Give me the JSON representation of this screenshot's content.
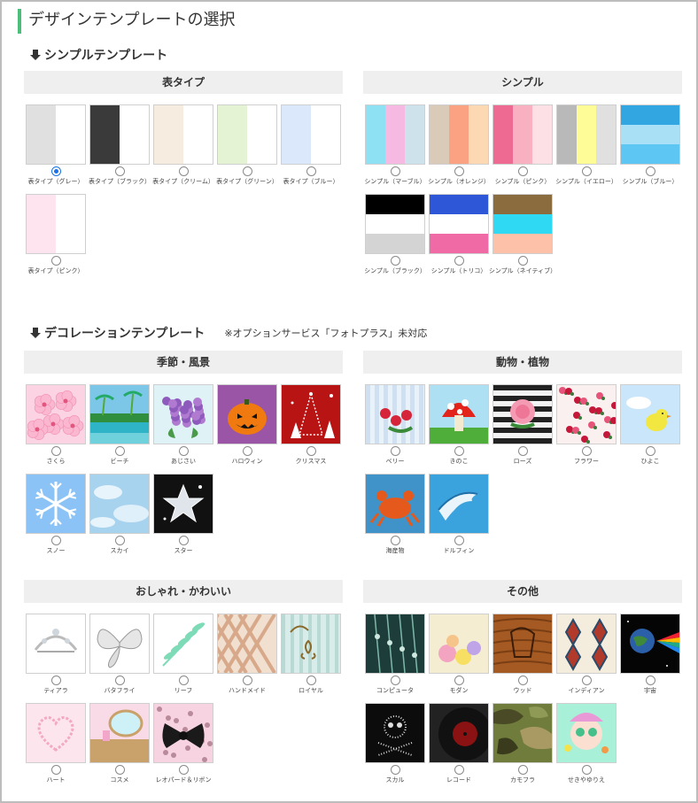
{
  "page_title": "デザインテンプレートの選択",
  "simple_section": {
    "title": "シンプルテンプレート",
    "groups": [
      {
        "header": "表タイプ",
        "items": [
          {
            "label": "表タイプ（グレー）",
            "selected": true,
            "colors": [
              "#e0e0e0",
              "#ffffff"
            ]
          },
          {
            "label": "表タイプ（ブラック）",
            "colors": [
              "#3a3a3a",
              "#ffffff"
            ]
          },
          {
            "label": "表タイプ（クリーム）",
            "colors": [
              "#f6ece0",
              "#ffffff"
            ]
          },
          {
            "label": "表タイプ（グリーン）",
            "colors": [
              "#e3f3d3",
              "#ffffff"
            ]
          },
          {
            "label": "表タイプ（ブルー）",
            "colors": [
              "#dbe8fb",
              "#ffffff"
            ]
          },
          {
            "label": "表タイプ（ピンク）",
            "colors": [
              "#fde4ef",
              "#ffffff"
            ]
          }
        ]
      },
      {
        "header": "シンプル",
        "items": [
          {
            "label": "シンプル（マーブル）",
            "colors": [
              "#8ee0f3",
              "#f6b9e1",
              "#cde2ea"
            ]
          },
          {
            "label": "シンプル（オレンジ）",
            "colors": [
              "#d9cbb7",
              "#fba282",
              "#fcd8b3"
            ]
          },
          {
            "label": "シンプル（ピンク）",
            "colors": [
              "#ef6a93",
              "#f9b1c2",
              "#fde0e6"
            ]
          },
          {
            "label": "シンプル（イエロー）",
            "colors": [
              "#b9b9b9",
              "#fdfc96",
              "#e0e0e0"
            ]
          },
          {
            "label": "シンプル（ブルー）",
            "colors": [
              "#31a6e0",
              "#a9e0f6",
              "#5ec6f2"
            ]
          },
          {
            "label": "シンプル（ブラック）",
            "colors": [
              "#000000",
              "#ffffff",
              "#d4d4d4"
            ]
          },
          {
            "label": "シンプル（トリコ）",
            "colors": [
              "#2d57d6",
              "#ffffff",
              "#f06aa6"
            ]
          },
          {
            "label": "シンプル（ネイティブ）",
            "colors": [
              "#8b6c3f",
              "#2fd9f4",
              "#fdc0a8"
            ]
          }
        ]
      }
    ]
  },
  "deco_section": {
    "title": "デコレーションテンプレート",
    "note": "※オプションサービス「フォトプラス」未対応",
    "groups": [
      {
        "header": "季節・風景",
        "items": [
          {
            "label": "さくら",
            "icon": "sakura-icon",
            "bg": "#fbd3e3"
          },
          {
            "label": "ビーチ",
            "icon": "beach-icon",
            "bg": "#7cc6e8"
          },
          {
            "label": "あじさい",
            "icon": "hydrangea-icon",
            "bg": "#dff3f6"
          },
          {
            "label": "ハロウィン",
            "icon": "pumpkin-icon",
            "bg": "#9a55a6"
          },
          {
            "label": "クリスマス",
            "icon": "christmas-tree-icon",
            "bg": "#b81414"
          },
          {
            "label": "スノー",
            "icon": "snowflake-icon",
            "bg": "#8cc3f6"
          },
          {
            "label": "スカイ",
            "icon": "sky-icon",
            "bg": "#a7d3ef"
          },
          {
            "label": "スター",
            "icon": "star-icon",
            "bg": "#111111"
          }
        ]
      },
      {
        "header": "動物・植物",
        "items": [
          {
            "label": "ベリー",
            "icon": "berry-icon",
            "bg": "#e8f2fa"
          },
          {
            "label": "きのこ",
            "icon": "mushroom-icon",
            "bg": "#aee0f4"
          },
          {
            "label": "ローズ",
            "icon": "rose-icon",
            "bg": "#f3f3f3"
          },
          {
            "label": "フラワー",
            "icon": "flower-icon",
            "bg": "#fbf0f0"
          },
          {
            "label": "ひよこ",
            "icon": "chick-icon",
            "bg": "#c9e6fa"
          },
          {
            "label": "海産物",
            "icon": "crab-icon",
            "bg": "#3f93c8"
          },
          {
            "label": "ドルフィン",
            "icon": "dolphin-icon",
            "bg": "#3aa2dc"
          }
        ]
      },
      {
        "header": "おしゃれ・かわいい",
        "items": [
          {
            "label": "ティアラ",
            "icon": "tiara-icon",
            "bg": "#ffffff"
          },
          {
            "label": "バタフライ",
            "icon": "butterfly-icon",
            "bg": "#ffffff"
          },
          {
            "label": "リーフ",
            "icon": "leaf-icon",
            "bg": "#ffffff"
          },
          {
            "label": "ハンドメイド",
            "icon": "handmade-icon",
            "bg": "#f1dfcf"
          },
          {
            "label": "ロイヤル",
            "icon": "royal-icon",
            "bg": "#d8ecea"
          },
          {
            "label": "ハート",
            "icon": "heart-icon",
            "bg": "#fde5ee"
          },
          {
            "label": "コスメ",
            "icon": "cosme-icon",
            "bg": "#f9dbe8"
          },
          {
            "label": "レオパード＆リボン",
            "icon": "leopard-ribbon-icon",
            "bg": "#f7d3e2"
          }
        ]
      },
      {
        "header": "その他",
        "items": [
          {
            "label": "コンピュータ",
            "icon": "computer-icon",
            "bg": "#1d3d3a"
          },
          {
            "label": "モダン",
            "icon": "modern-icon",
            "bg": "#f5edd2"
          },
          {
            "label": "ウッド",
            "icon": "wood-icon",
            "bg": "#a45a22"
          },
          {
            "label": "インディアン",
            "icon": "indian-icon",
            "bg": "#f4ecdc"
          },
          {
            "label": "宇宙",
            "icon": "space-icon",
            "bg": "#050505"
          },
          {
            "label": "スカル",
            "icon": "skull-icon",
            "bg": "#0c0c0c"
          },
          {
            "label": "レコード",
            "icon": "record-icon",
            "bg": "#222222"
          },
          {
            "label": "カモフラ",
            "icon": "camo-icon",
            "bg": "#6f7c3c"
          },
          {
            "label": "せきやゆりえ",
            "icon": "illustration-icon",
            "bg": "#a8f0d8"
          }
        ]
      }
    ]
  }
}
